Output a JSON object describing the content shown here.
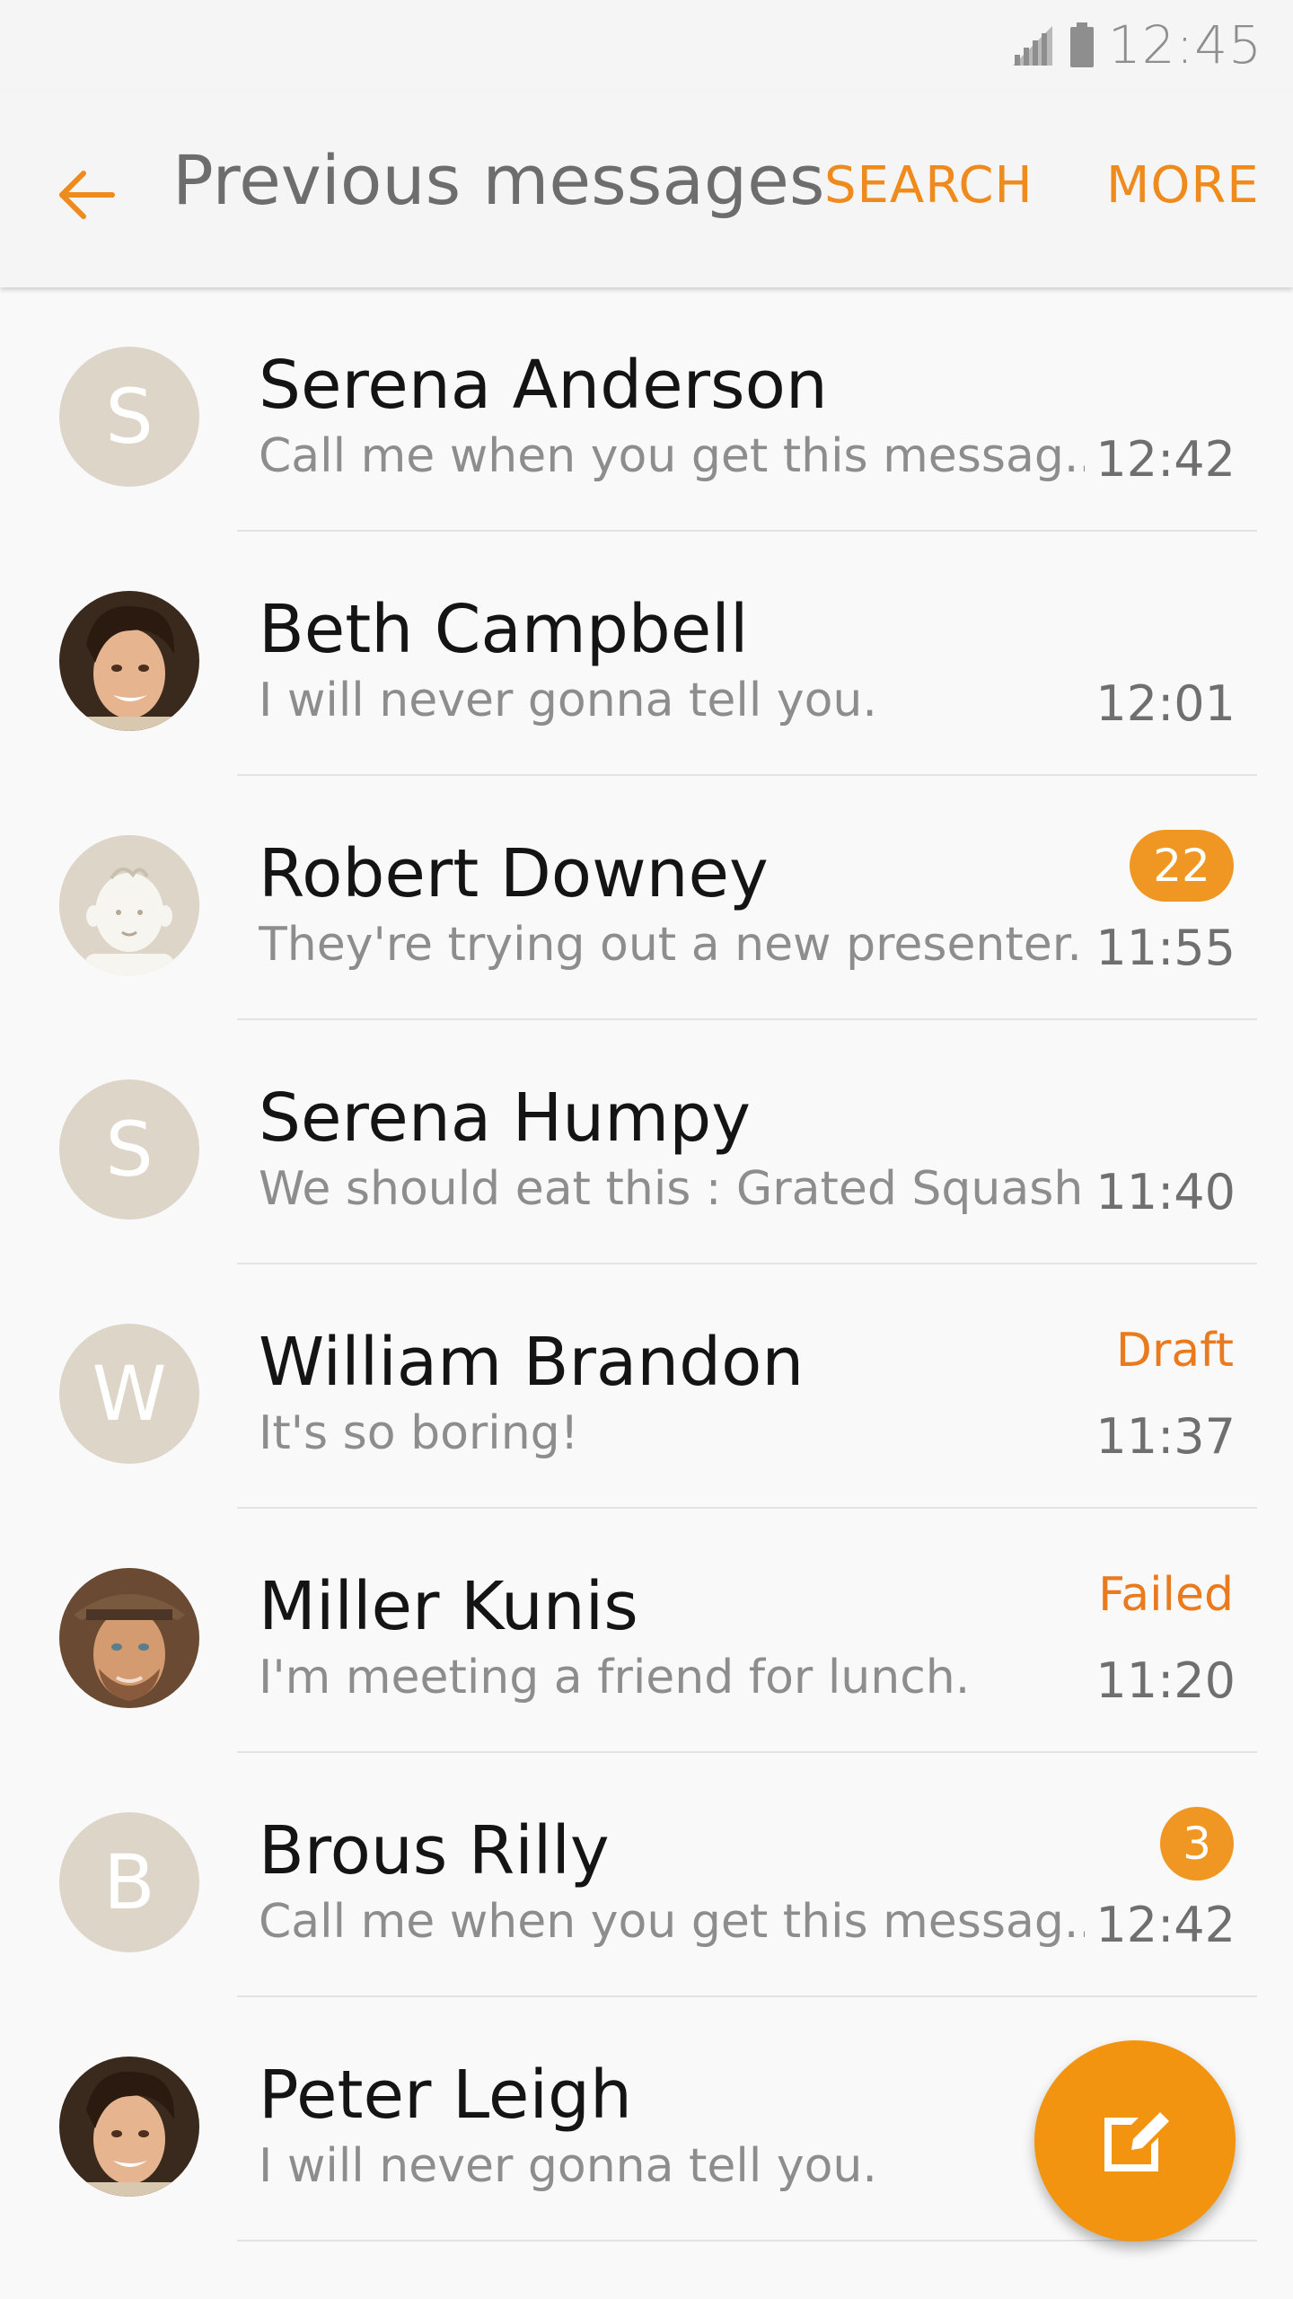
{
  "status_bar": {
    "time": "12:45",
    "icons": [
      "signal-icon",
      "battery-icon"
    ]
  },
  "app_bar": {
    "back_icon": "arrow-left-icon",
    "title": "Previous messages",
    "search_label": "SEARCH",
    "more_label": "MORE"
  },
  "colors": {
    "accent": "#ef8a1c",
    "badge": "#f09622",
    "avatar_placeholder": "#dcd5c8",
    "fab": "#f2940f"
  },
  "conversations": [
    {
      "name": "Serena Anderson",
      "snippet": "Call me when you get this messag...",
      "time": "12:42",
      "avatar_letter": "S",
      "avatar_type": "letter"
    },
    {
      "name": "Beth Campbell",
      "snippet": "I will never gonna tell you.",
      "time": "12:01",
      "avatar_type": "photo-young-man"
    },
    {
      "name": "Robert Downey",
      "snippet": "They're trying out a new presenter...",
      "time": "11:55",
      "avatar_type": "default-contact",
      "badge": "22"
    },
    {
      "name": "Serena Humpy",
      "snippet": "We should eat this : Grated Squash",
      "time": "11:40",
      "avatar_letter": "S",
      "avatar_type": "letter"
    },
    {
      "name": "William Brandon",
      "snippet": "It's so boring!",
      "time": "11:37",
      "avatar_letter": "W",
      "avatar_type": "letter",
      "state": "Draft"
    },
    {
      "name": "Miller Kunis",
      "snippet": "I'm meeting a friend for lunch.",
      "time": "11:20",
      "avatar_type": "photo-man-hat",
      "state": "Failed"
    },
    {
      "name": "Brous Rilly",
      "snippet": "Call me when you get this messag...",
      "time": "12:42",
      "avatar_letter": "B",
      "avatar_type": "letter",
      "badge": "3"
    },
    {
      "name": "Peter Leigh",
      "snippet": "I will never gonna tell you.",
      "time": "",
      "avatar_type": "photo-young-man"
    }
  ],
  "fab": {
    "icon": "compose-icon"
  }
}
